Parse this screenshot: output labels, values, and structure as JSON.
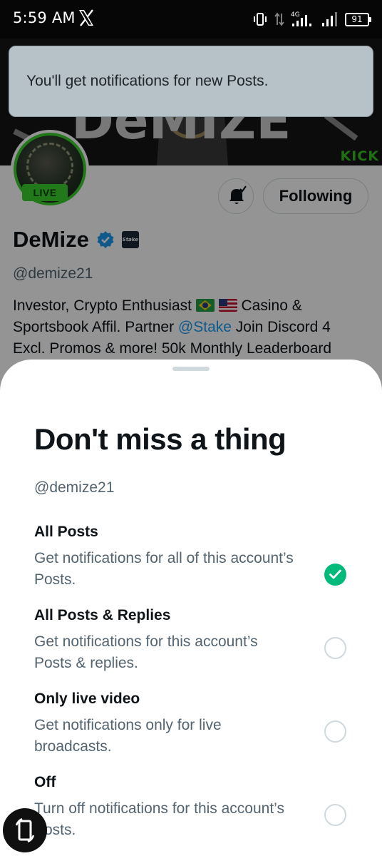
{
  "status_bar": {
    "time": "5:59 AM",
    "battery": "91",
    "icons": [
      "x-logo-icon",
      "vibrate-icon",
      "data-arrows-icon",
      "signal-4g-icon",
      "signal-icon",
      "battery-icon"
    ]
  },
  "toast": {
    "text": "You'll get notifications for new Posts."
  },
  "profile": {
    "banner_text": "KICK",
    "live_badge": "LIVE",
    "following_label": "Following",
    "name": "DeMize",
    "stake_badge": "Stake",
    "handle": "@demize21",
    "bio": {
      "line1_a": "Investor, Crypto Enthusiast",
      "line1_b": "Casino &",
      "line2_a": "Sportsbook Affil. Partner ",
      "mention": "@Stake",
      "line2_b": " Join Discord 4",
      "line3": "Excl. Promos & more! 50k Monthly Leaderboard"
    }
  },
  "sheet": {
    "title": "Don't miss a thing",
    "handle": "@demize21",
    "options": [
      {
        "title": "All Posts",
        "description": "Get notifications for all of this account’s Posts.",
        "selected": true
      },
      {
        "title": "All Posts & Replies",
        "description": "Get notifications for this account’s Posts & replies.",
        "selected": false
      },
      {
        "title": "Only live video",
        "description": "Get notifications only for live broadcasts.",
        "selected": false
      },
      {
        "title": "Off",
        "description": "Turn off notifications for this account’s Posts.",
        "selected": false
      }
    ]
  },
  "colors": {
    "accent_green": "#00ba7c",
    "live_green": "#3bd12c",
    "link_blue": "#1d9bf0",
    "text_primary": "#0f1419",
    "text_secondary": "#536471"
  }
}
